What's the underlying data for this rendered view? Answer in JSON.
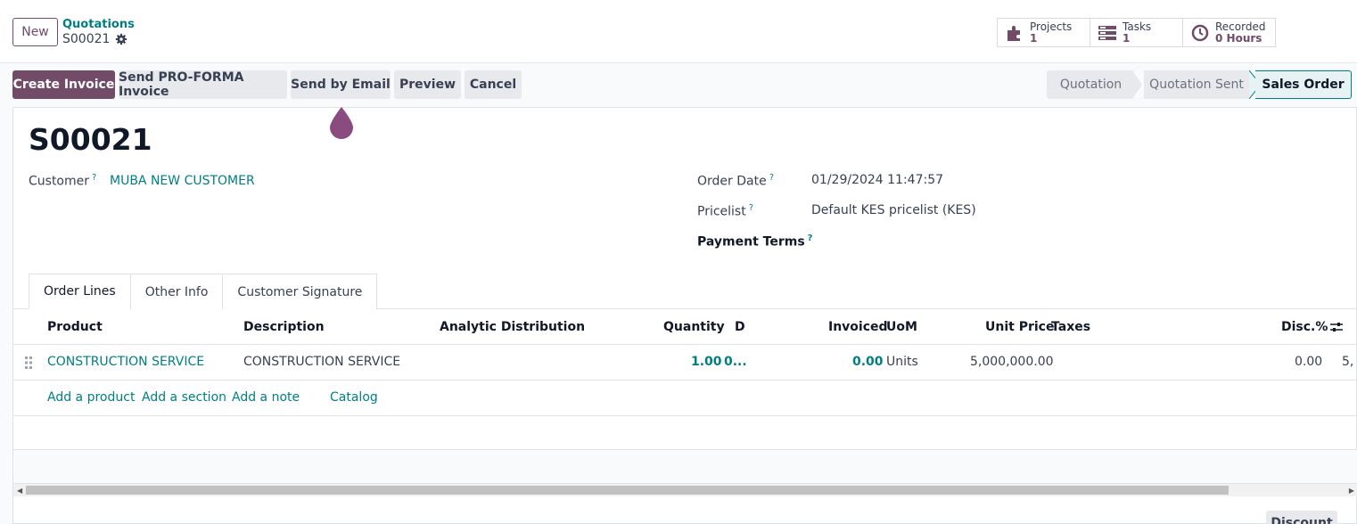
{
  "topbar": {
    "new_label": "New",
    "breadcrumb_parent": "Quotations",
    "breadcrumb_current": "S00021",
    "smart_buttons": [
      {
        "label": "Projects",
        "value": "1",
        "icon": "puzzle-icon"
      },
      {
        "label": "Tasks",
        "value": "1",
        "icon": "tasks-icon"
      },
      {
        "label": "Recorded",
        "value": "0 Hours",
        "icon": "clock-icon"
      }
    ]
  },
  "actions": {
    "create_invoice": "Create Invoice",
    "send_proforma": "Send PRO-FORMA Invoice",
    "send_email": "Send by Email",
    "preview": "Preview",
    "cancel": "Cancel"
  },
  "statusbar": {
    "steps": [
      "Quotation",
      "Quotation Sent",
      "Sales Order"
    ],
    "active": "Sales Order"
  },
  "form": {
    "title": "S00021",
    "customer_label": "Customer",
    "customer_value": "MUBA NEW CUSTOMER",
    "order_date_label": "Order Date",
    "order_date_value": "01/29/2024 11:47:57",
    "pricelist_label": "Pricelist",
    "pricelist_value": "Default KES pricelist (KES)",
    "payment_terms_label": "Payment Terms",
    "help_mark": "?"
  },
  "tabs": [
    "Order Lines",
    "Other Info",
    "Customer Signature"
  ],
  "table": {
    "headers": {
      "product": "Product",
      "description": "Description",
      "analytic": "Analytic Distribution",
      "quantity": "Quantity",
      "delivered": "D",
      "invoiced": "Invoiced",
      "uom": "UoM",
      "unit_price": "Unit Price",
      "taxes": "Taxes",
      "disc": "Disc.%"
    },
    "rows": [
      {
        "product": "CONSTRUCTION SERVICE",
        "description": "CONSTRUCTION SERVICE",
        "quantity": "1.00",
        "delivered": "0...",
        "invoiced": "0.00",
        "uom": "Units",
        "unit_price": "5,000,000.00",
        "disc": "0.00",
        "subtotal_clipped": "5,"
      }
    ],
    "add_links": [
      "Add a product",
      "Add a section",
      "Add a note",
      "Catalog"
    ]
  },
  "footer": {
    "discount_label": "Discount"
  },
  "colors": {
    "brand": "#714b67",
    "link": "#017e84"
  }
}
